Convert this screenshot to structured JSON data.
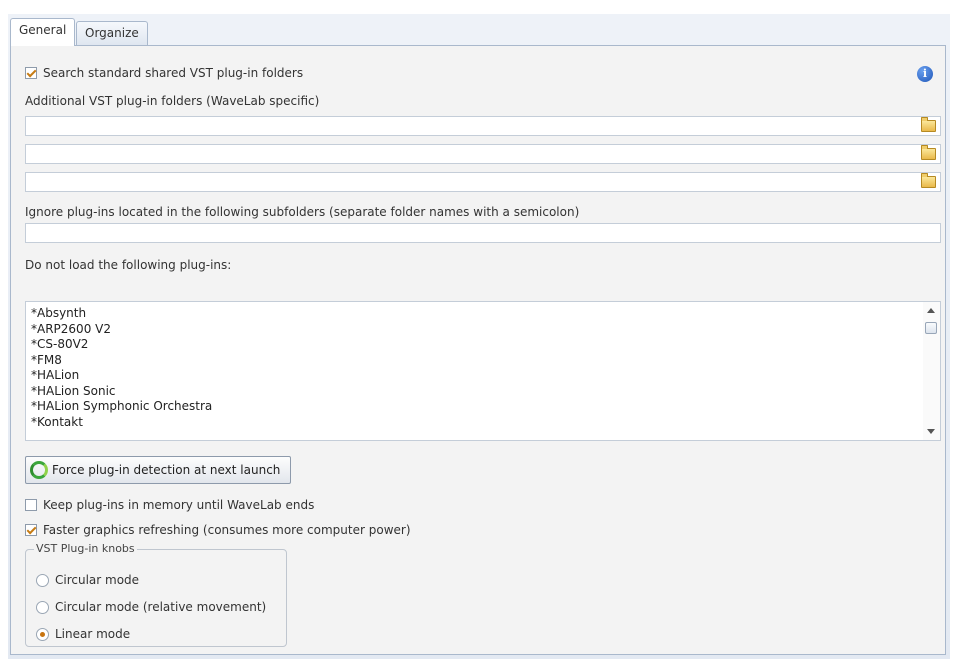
{
  "tabs": [
    {
      "label": "General",
      "active": true
    },
    {
      "label": "Organize",
      "active": false
    }
  ],
  "search_standard": {
    "label": "Search standard shared VST plug-in folders",
    "checked": true
  },
  "additional_folders": {
    "label": "Additional VST plug-in folders (WaveLab specific)",
    "values": [
      "",
      "",
      ""
    ]
  },
  "ignore_subfolders": {
    "label": "Ignore plug-ins located in the following subfolders (separate folder names with a semicolon)",
    "value": ""
  },
  "do_not_load": {
    "label": "Do not load the following plug-ins:",
    "items": [
      "*Absynth",
      "*ARP2600 V2",
      "*CS-80V2",
      "*FM8",
      "*HALion",
      "*HALion Sonic",
      "*HALion Symphonic Orchestra",
      "*Kontakt"
    ]
  },
  "force_detection_button": {
    "label": "Force plug-in detection at next launch"
  },
  "keep_in_memory": {
    "label": "Keep plug-ins in memory until WaveLab ends",
    "checked": false
  },
  "faster_graphics": {
    "label": "Faster graphics refreshing (consumes more computer power)",
    "checked": true
  },
  "knobs_group": {
    "title": "VST Plug-in knobs",
    "options": [
      {
        "label": "Circular mode",
        "selected": false
      },
      {
        "label": "Circular mode (relative movement)",
        "selected": false
      },
      {
        "label": "Linear mode",
        "selected": true
      }
    ]
  },
  "icons": {
    "info": "info-icon",
    "folder": "folder-icon",
    "refresh": "refresh-icon"
  },
  "colors": {
    "accent_check": "#c67c15",
    "info_blue": "#1f56b8",
    "refresh_green": "#3ba63b"
  }
}
